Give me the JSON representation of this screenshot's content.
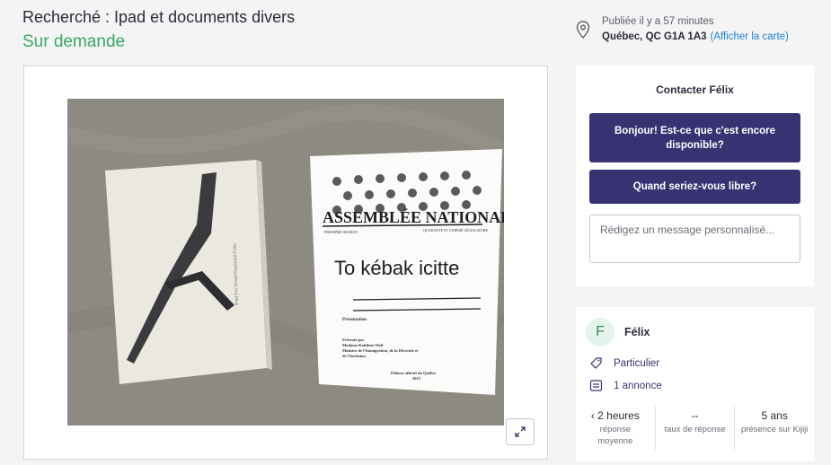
{
  "listing": {
    "title": "Recherché : Ipad et documents divers",
    "price": "Sur demande"
  },
  "meta": {
    "posted": "Publiée il y a 57 minutes",
    "location": "Québec, QC G1A 1A3",
    "map_link": "(Afficher la carte)"
  },
  "photo": {
    "box_label": "iPad Pro\nSmart Keyboard Folio",
    "doc_header": "ASSEMBLÉE NATIONALE",
    "doc_sub_left": "PREMIÈRE SESSION",
    "doc_sub_right": "QUARANTE ET UNIÈME LÉGISLATURE",
    "doc_main": "To kébak icitte",
    "doc_presentation": "Présentation",
    "doc_presented_by": "Présenté par",
    "doc_minister": "Madame Kathleen Weil",
    "doc_ministry": "Ministre de l'Immigration, de la Diversité et",
    "doc_ministry2": "de l'Inclusion",
    "doc_editor": "Éditeur officiel du Québec",
    "doc_year": "2015"
  },
  "contact": {
    "title": "Contacter Félix",
    "quick_reply_1": "Bonjour! Est-ce que c'est encore disponible?",
    "quick_reply_2": "Quand seriez-vous libre?",
    "message_placeholder": "Rédigez un message personnalisé..."
  },
  "seller": {
    "initial": "F",
    "name": "Félix",
    "type": "Particulier",
    "listings": "1 annonce",
    "stats": [
      {
        "value": "‹ 2 heures",
        "label": "réponse moyenne"
      },
      {
        "value": "--",
        "label": "taux de réponse"
      },
      {
        "value": "5 ans",
        "label": "présence sur Kijiji"
      }
    ]
  },
  "colors": {
    "accent": "#373373",
    "price_green": "#37a864",
    "link_blue": "#1d7fd6"
  }
}
